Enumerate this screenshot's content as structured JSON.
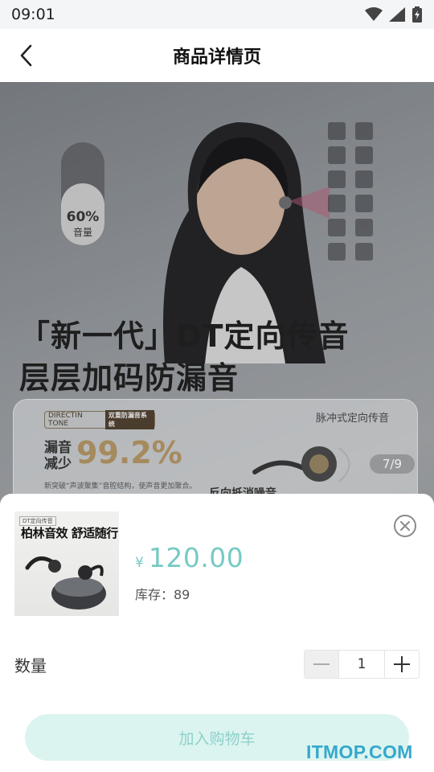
{
  "status_bar": {
    "time": "09:01"
  },
  "nav": {
    "title": "商品详情页"
  },
  "banner": {
    "volume_percent": "60%",
    "volume_label": "音量",
    "volume_level": 0.6,
    "headline_line1": "「新一代」DT定向传音",
    "headline_line2": "层层加码防漏音",
    "feature": {
      "logo_text": "DIRECTIN TONE",
      "logo_badge": "双重防漏音系统",
      "reduce_label": "漏音减少",
      "reduce_value": "99.2%",
      "small_text": "新突破“声波聚集”音腔结构，使声音更加聚合。",
      "pulse_text": "脉冲式定向传音",
      "page_indicator": "7/9",
      "bottom_text": "反向抵消噪音"
    }
  },
  "sheet": {
    "thumb_badge": "柏林音效 舒适随行",
    "thumb_top": "DT定向传音",
    "price_symbol": "¥",
    "price": "120.00",
    "stock": "库存：89",
    "quantity_label": "数量",
    "quantity_value": "1",
    "add_to_cart": "加入购物车"
  },
  "watermark": "ITMOP.COM",
  "colors": {
    "accent": "#76cac4",
    "button_bg": "#dbf4f0",
    "button_text": "#8fd0c9",
    "watermark": "#35a8cc"
  }
}
